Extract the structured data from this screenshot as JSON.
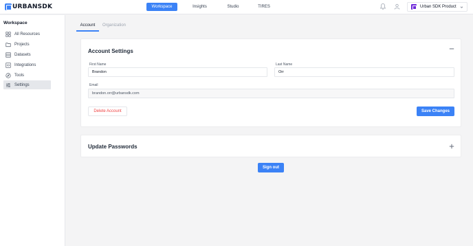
{
  "app": {
    "logo_text": "URBANSDK",
    "brand_color": "#3b82f6"
  },
  "topnav": {
    "tabs": [
      {
        "label": "Workspace",
        "active": true
      },
      {
        "label": "Insights",
        "active": false
      },
      {
        "label": "Studio",
        "active": false
      },
      {
        "label": "TIRES",
        "active": false
      }
    ],
    "icons": [
      "bell-icon",
      "user-icon"
    ],
    "product_selector": {
      "label": "Urban SDK Product",
      "icon": "product-logo-icon"
    }
  },
  "sidebar": {
    "title": "Workspace",
    "items": [
      {
        "label": "All Resources",
        "icon": "grid-icon",
        "active": false
      },
      {
        "label": "Projects",
        "icon": "folder-icon",
        "active": false
      },
      {
        "label": "Datasets",
        "icon": "table-icon",
        "active": false
      },
      {
        "label": "Integrations",
        "icon": "integrations-icon",
        "active": false
      },
      {
        "label": "Tools",
        "icon": "compass-icon",
        "active": false
      },
      {
        "label": "Settings",
        "icon": "sliders-icon",
        "active": true
      }
    ]
  },
  "settings_tabs": [
    {
      "label": "Account",
      "active": true
    },
    {
      "label": "Organization",
      "active": false
    }
  ],
  "account_settings": {
    "title": "Account Settings",
    "first_name_label": "First Name",
    "first_name_value": "Brandon",
    "last_name_label": "Last Name",
    "last_name_value": "Orr",
    "email_label": "Email",
    "email_value": "brandon.orr@urbansdk.com",
    "delete_label": "Delete Account",
    "save_label": "Save Changes"
  },
  "update_passwords": {
    "title": "Update Passwords"
  },
  "sign_out_label": "Sign out",
  "colors": {
    "accent": "#3b82f6",
    "danger": "#ef4444",
    "product_badge": "#6d28d9"
  }
}
